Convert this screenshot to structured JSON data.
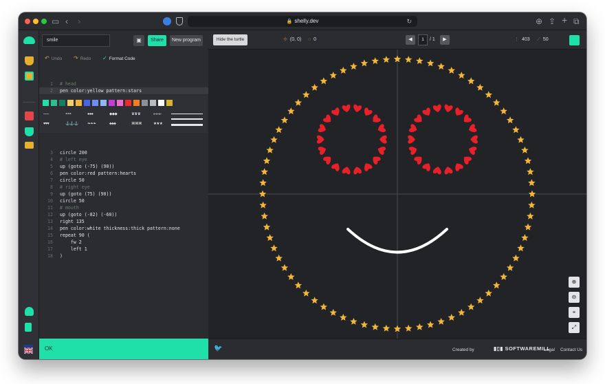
{
  "browser": {
    "url": "shelly.dev"
  },
  "editor": {
    "program_name": "smile",
    "share_label": "Share",
    "new_program_label": "New program",
    "undo_label": "Undo",
    "redo_label": "Redo",
    "format_label": "Format Code",
    "status": "OK",
    "lines": [
      {
        "n": "1",
        "text": "# head"
      },
      {
        "n": "2",
        "text": "pen color:yellow pattern:stars"
      },
      {
        "n": "3",
        "text": "circle 200"
      },
      {
        "n": "4",
        "text": "# left eye"
      },
      {
        "n": "5",
        "text": "up (goto (-75) (90))"
      },
      {
        "n": "6",
        "text": "pen color:red pattern:hearts"
      },
      {
        "n": "7",
        "text": "circle 50"
      },
      {
        "n": "8",
        "text": "# right eye"
      },
      {
        "n": "9",
        "text": "up (goto (75) (90))"
      },
      {
        "n": "10",
        "text": "circle 50"
      },
      {
        "n": "11",
        "text": "# mouth"
      },
      {
        "n": "12",
        "text": "up (goto (-82) (-60))"
      },
      {
        "n": "13",
        "text": "right 135"
      },
      {
        "n": "14",
        "text": "pen color:white thickness:thick pattern:none"
      },
      {
        "n": "15",
        "text": "repeat 90 ("
      },
      {
        "n": "16",
        "text": "    fw 2"
      },
      {
        "n": "17",
        "text": "    left 1"
      },
      {
        "n": "18",
        "text": ")"
      }
    ],
    "palette": [
      "#1fe0a8",
      "#2fbf8f",
      "#16805e",
      "#f4d06a",
      "#f0b73c",
      "#4466e6",
      "#6f8ff0",
      "#8fb6f5",
      "#c53bd6",
      "#f26bd0",
      "#ee2b2b",
      "#f47e1f",
      "#8d9096",
      "#b8bcc2",
      "#ffffff",
      "#d9b22e"
    ],
    "patterns_row1": [
      "⏤⏤",
      "◓◓◓",
      "●●●",
      "◆◆◆",
      "♛♛♛",
      "⟜⟜⟜"
    ],
    "patterns_row2": [
      "♥♥♥",
      "⚓⚓⚓",
      "❧❧❧",
      "♣♣♣",
      "⌘⌘⌘",
      "★★★"
    ]
  },
  "toolbar": {
    "hide_turtle_label": "Hide the turtle",
    "position": "(0, 0)",
    "angle": "0",
    "page_current": "1",
    "page_total": "/ 1",
    "width": "403",
    "speed": "50"
  },
  "footer": {
    "created_by": "Created by",
    "brand": "SOFTWAREMILL",
    "legal": "Legal",
    "contact": "Contact Us"
  },
  "colors": {
    "accent": "#1fe0a8",
    "star": "#f2b73a",
    "heart": "#e8202a",
    "mouth": "#ffffff"
  }
}
